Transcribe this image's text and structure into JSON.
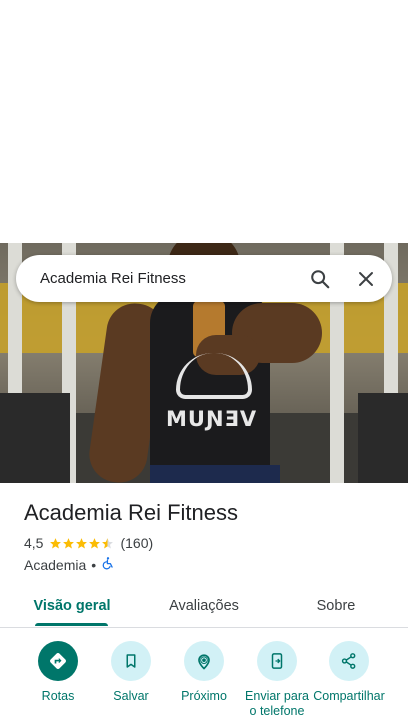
{
  "search": {
    "query": "Academia Rei Fitness"
  },
  "photo": {
    "shirt_text": "MUƝƎV"
  },
  "place": {
    "name": "Academia Rei Fitness",
    "rating": "4,5",
    "rating_value": 4.5,
    "reviews": "(160)",
    "category": "Academia",
    "separator": "•"
  },
  "tabs": [
    {
      "label": "Visão geral"
    },
    {
      "label": "Avaliações"
    },
    {
      "label": "Sobre"
    }
  ],
  "actions": [
    {
      "label": "Rotas",
      "icon": "directions-icon"
    },
    {
      "label": "Salvar",
      "icon": "bookmark-icon"
    },
    {
      "label": "Próximo",
      "icon": "nearby-icon"
    },
    {
      "label": "Enviar para o telefone",
      "icon": "send-to-phone-icon"
    },
    {
      "label": "Compartilhar",
      "icon": "share-icon"
    }
  ],
  "colors": {
    "accent": "#00766a",
    "chip": "#d2f1f6",
    "star": "#fbbc04"
  }
}
